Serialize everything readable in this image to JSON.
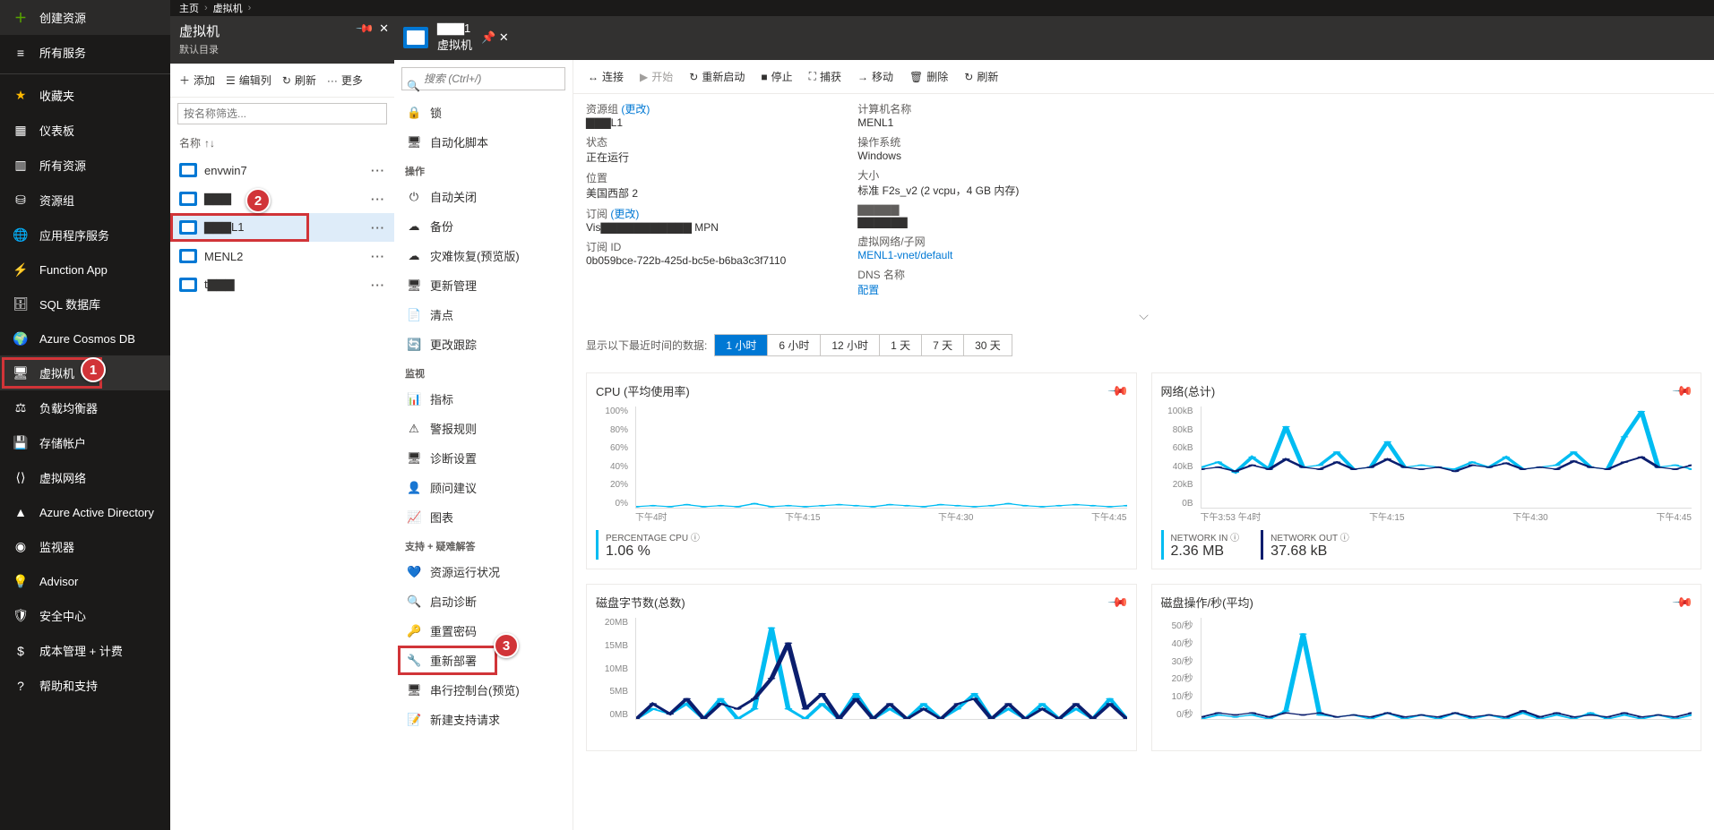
{
  "breadcrumb": [
    "主页",
    "虚拟机"
  ],
  "leftnav": {
    "create": "创建资源",
    "all_services": "所有服务",
    "favorites": "收藏夹",
    "items": [
      "仪表板",
      "所有资源",
      "资源组",
      "应用程序服务",
      "Function App",
      "SQL 数据库",
      "Azure Cosmos DB",
      "虚拟机",
      "负载均衡器",
      "存储帐户",
      "虚拟网络",
      "Azure Active Directory",
      "监视器",
      "Advisor",
      "安全中心",
      "成本管理 + 计费",
      "帮助和支持"
    ]
  },
  "vmcol": {
    "title": "虚拟机",
    "subtitle": "默认目录",
    "tools": {
      "add": "添加",
      "columns": "编辑列",
      "refresh": "刷新",
      "more": "更多"
    },
    "filter_placeholder": "按名称筛选...",
    "header": "名称",
    "rows": [
      "envwin7",
      "▇▇▇",
      "▇▇▇L1",
      "MENL2",
      "t▇▇▇"
    ],
    "selected_index": 2
  },
  "setmenu": {
    "search_placeholder": "搜索 (Ctrl+/)",
    "items": [
      {
        "icon": "🔒",
        "label": "锁"
      },
      {
        "icon": "🖥",
        "label": "自动化脚本"
      }
    ],
    "group_ops": "操作",
    "ops": [
      {
        "icon": "⏻",
        "label": "自动关闭"
      },
      {
        "icon": "☁",
        "label": "备份"
      },
      {
        "icon": "☁",
        "label": "灾难恢复(预览版)"
      },
      {
        "icon": "🖥",
        "label": "更新管理"
      },
      {
        "icon": "📄",
        "label": "清点"
      },
      {
        "icon": "🔄",
        "label": "更改跟踪"
      }
    ],
    "group_mon": "监视",
    "mon": [
      {
        "icon": "📊",
        "label": "指标"
      },
      {
        "icon": "⚠",
        "label": "警报规则"
      },
      {
        "icon": "🖥",
        "label": "诊断设置"
      },
      {
        "icon": "👤",
        "label": "顾问建议"
      },
      {
        "icon": "📈",
        "label": "图表"
      }
    ],
    "group_sup": "支持 + 疑难解答",
    "sup": [
      {
        "icon": "💙",
        "label": "资源运行状况"
      },
      {
        "icon": "🔍",
        "label": "启动诊断"
      },
      {
        "icon": "🔑",
        "label": "重置密码"
      },
      {
        "icon": "🔧",
        "label": "重新部署"
      },
      {
        "icon": "🖥",
        "label": "串行控制台(预览)"
      },
      {
        "icon": "📝",
        "label": "新建支持请求"
      }
    ]
  },
  "dethead": {
    "title": "▇▇▇1",
    "subtitle": "虚拟机"
  },
  "cmdbar": {
    "connect": "连接",
    "start": "开始",
    "restart": "重新启动",
    "stop": "停止",
    "capture": "捕获",
    "move": "移动",
    "delete": "删除",
    "refresh": "刷新"
  },
  "props": {
    "left": [
      {
        "label": "资源组 ",
        "link": "(更改)",
        "value": "▇▇▇L1"
      },
      {
        "label": "状态",
        "value": "正在运行"
      },
      {
        "label": "位置",
        "value": "美国西部 2"
      },
      {
        "label": "订阅 ",
        "link": "(更改)",
        "value": "Vis▇▇▇▇▇▇▇▇▇▇▇ MPN"
      },
      {
        "label": "订阅 ID",
        "value": "0b059bce-722b-425d-bc5e-b6ba3c3f7110"
      }
    ],
    "right": [
      {
        "label": "计算机名称",
        "value": "MENL1"
      },
      {
        "label": "操作系统",
        "value": "Windows"
      },
      {
        "label": "大小",
        "value": "标准 F2s_v2 (2 vcpu，4 GB 内存)"
      },
      {
        "label": "▇▇▇▇▇",
        "value": "▇▇▇▇▇▇"
      },
      {
        "label": "虚拟网络/子网",
        "value": "MENL1-vnet/default",
        "link_value": true
      },
      {
        "label": "DNS 名称",
        "value": "配置",
        "link_value": true
      }
    ]
  },
  "timebar": {
    "label": "显示以下最近时间的数据:",
    "options": [
      "1 小时",
      "6 小时",
      "12 小时",
      "1 天",
      "7 天",
      "30 天"
    ],
    "selected": 0
  },
  "chart_data": [
    {
      "title": "CPU (平均使用率)",
      "type": "line",
      "x": [
        "下午4时",
        "下午4:15",
        "下午4:30",
        "下午4:45"
      ],
      "yticks": [
        "100%",
        "80%",
        "60%",
        "40%",
        "20%",
        "0%"
      ],
      "ylim": [
        0,
        100
      ],
      "series": [
        {
          "name": "PERCENTAGE CPU",
          "color": "#00bcf2",
          "values": [
            1,
            2,
            1,
            3,
            1,
            2,
            1,
            4,
            1,
            2,
            1,
            2,
            3,
            2,
            1,
            3,
            2,
            1,
            3,
            2,
            1,
            2,
            4,
            2,
            1,
            2,
            3,
            2,
            1,
            2
          ]
        }
      ],
      "legend": [
        {
          "label": "PERCENTAGE CPU",
          "icon": "ⓘ",
          "value": "1.06 %",
          "color": "#00bcf2"
        }
      ]
    },
    {
      "title": "网络(总计)",
      "type": "line",
      "x": [
        "下午3:53 午4时",
        "下午4:15",
        "下午4:30",
        "下午4:45"
      ],
      "yticks": [
        "100kB",
        "80kB",
        "60kB",
        "40kB",
        "20kB",
        "0B"
      ],
      "ylim": [
        0,
        100
      ],
      "series": [
        {
          "name": "NETWORK IN",
          "color": "#00bcf2",
          "values": [
            40,
            45,
            35,
            50,
            38,
            80,
            40,
            42,
            55,
            38,
            40,
            65,
            40,
            42,
            40,
            38,
            45,
            40,
            50,
            38,
            40,
            42,
            55,
            40,
            38,
            70,
            95,
            40,
            42,
            38
          ]
        },
        {
          "name": "NETWORK OUT",
          "color": "#0b1e6e",
          "values": [
            38,
            40,
            36,
            42,
            38,
            48,
            40,
            38,
            45,
            38,
            40,
            48,
            40,
            38,
            40,
            36,
            42,
            40,
            44,
            38,
            40,
            38,
            46,
            40,
            38,
            45,
            50,
            40,
            38,
            42
          ]
        }
      ],
      "legend": [
        {
          "label": "NETWORK IN",
          "icon": "ⓘ",
          "value": "2.36 MB",
          "color": "#00bcf2"
        },
        {
          "label": "NETWORK OUT",
          "icon": "ⓘ",
          "value": "37.68 kB",
          "color": "#0b1e6e"
        }
      ]
    },
    {
      "title": "磁盘字节数(总数)",
      "type": "line",
      "x": [],
      "yticks": [
        "20MB",
        "15MB",
        "10MB",
        "5MB",
        "0MB"
      ],
      "ylim": [
        0,
        20
      ],
      "series": [
        {
          "name": "Read",
          "color": "#00bcf2",
          "values": [
            0,
            2,
            1,
            3,
            0,
            4,
            0,
            2,
            18,
            2,
            0,
            3,
            0,
            5,
            0,
            2,
            0,
            3,
            0,
            2,
            5,
            0,
            2,
            0,
            3,
            0,
            2,
            0,
            4,
            0
          ]
        },
        {
          "name": "Write",
          "color": "#0b1e6e",
          "values": [
            0,
            3,
            1,
            4,
            0,
            3,
            2,
            4,
            8,
            15,
            2,
            5,
            0,
            4,
            0,
            3,
            0,
            2,
            0,
            3,
            4,
            0,
            3,
            0,
            2,
            0,
            3,
            0,
            3,
            0
          ]
        }
      ],
      "legend": []
    },
    {
      "title": "磁盘操作/秒(平均)",
      "type": "line",
      "x": [],
      "yticks": [
        "50/秒",
        "40/秒",
        "30/秒",
        "20/秒",
        "10/秒",
        "0/秒"
      ],
      "ylim": [
        0,
        50
      ],
      "series": [
        {
          "name": "Read ops",
          "color": "#00bcf2",
          "values": [
            0,
            2,
            1,
            2,
            0,
            4,
            42,
            2,
            1,
            2,
            0,
            3,
            0,
            2,
            0,
            3,
            0,
            2,
            0,
            3,
            0,
            2,
            0,
            3,
            0,
            2,
            0,
            2,
            0,
            2
          ]
        },
        {
          "name": "Write ops",
          "color": "#0b1e6e",
          "values": [
            1,
            3,
            2,
            3,
            1,
            3,
            2,
            3,
            1,
            2,
            1,
            3,
            1,
            2,
            1,
            3,
            1,
            2,
            1,
            4,
            1,
            3,
            1,
            2,
            1,
            3,
            1,
            2,
            1,
            3
          ]
        }
      ],
      "legend": []
    }
  ],
  "badges": [
    "1",
    "2",
    "3"
  ]
}
